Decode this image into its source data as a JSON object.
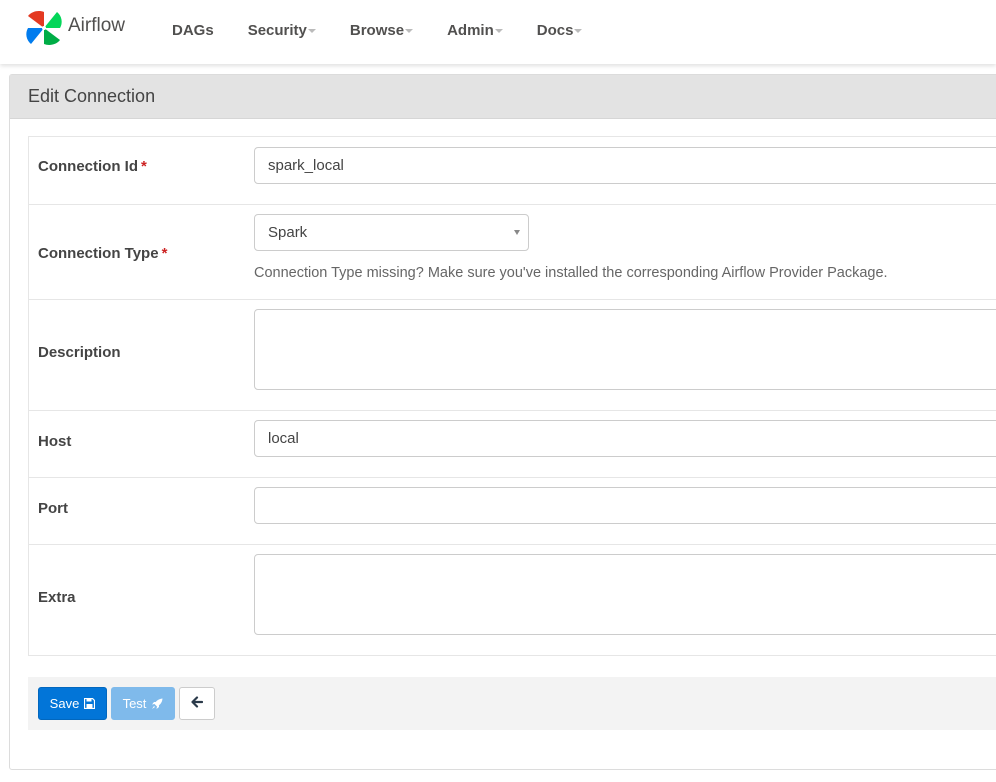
{
  "app": {
    "name": "Airflow",
    "logo_icon": "airflow-pinwheel-icon",
    "colors": {
      "logo": [
        "#017cee",
        "#00ad46",
        "#e43921",
        "#04d659"
      ],
      "primary_button": "#0275d8",
      "disabled_button": "#7fbaeb",
      "required_marker": "#cc2222"
    }
  },
  "nav": {
    "items": [
      {
        "label": "DAGs",
        "has_dropdown": false
      },
      {
        "label": "Security",
        "has_dropdown": true
      },
      {
        "label": "Browse",
        "has_dropdown": true
      },
      {
        "label": "Admin",
        "has_dropdown": true
      },
      {
        "label": "Docs",
        "has_dropdown": true
      }
    ]
  },
  "panel": {
    "title": "Edit Connection"
  },
  "form": {
    "required_marker": "*",
    "connection_id": {
      "label": "Connection Id",
      "value": "spark_local",
      "required": true
    },
    "connection_type": {
      "label": "Connection Type",
      "value": "Spark",
      "required": true,
      "help": "Connection Type missing? Make sure you've installed the corresponding Airflow Provider Package."
    },
    "description": {
      "label": "Description",
      "value": ""
    },
    "host": {
      "label": "Host",
      "value": "local"
    },
    "port": {
      "label": "Port",
      "value": ""
    },
    "extra": {
      "label": "Extra",
      "value": ""
    }
  },
  "actions": {
    "save_label": "Save",
    "save_icon": "floppy-disk-icon",
    "test_label": "Test",
    "test_icon": "rocket-icon",
    "test_disabled": true,
    "back_icon": "arrow-left-icon"
  }
}
